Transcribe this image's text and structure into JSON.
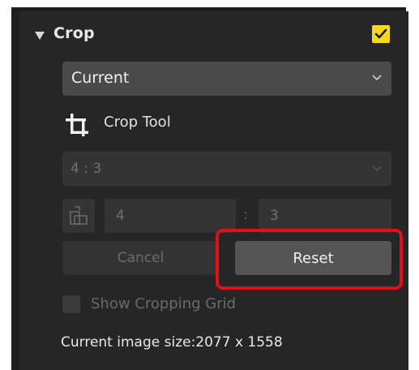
{
  "colors": {
    "panel_bg": "#262626",
    "accent_checkbox": "#f5d91a",
    "highlight_border": "#e0101a"
  },
  "section": {
    "title": "Crop",
    "expanded_icon": "triangle-down-icon",
    "enabled": true
  },
  "preset_select": {
    "value": "Current"
  },
  "crop_tool": {
    "icon": "crop-icon",
    "label": "Crop Tool"
  },
  "aspect_ratio_select": {
    "value": "4 : 3",
    "disabled": true
  },
  "ratio_inputs": {
    "width": "4",
    "separator": ":",
    "height": "3",
    "disabled": true
  },
  "buttons": {
    "cancel_label": "Cancel",
    "reset_label": "Reset"
  },
  "grid_option": {
    "label": "Show Cropping Grid",
    "checked": false,
    "disabled": true
  },
  "image_size": {
    "text": "Current image size:2077 x 1558"
  }
}
